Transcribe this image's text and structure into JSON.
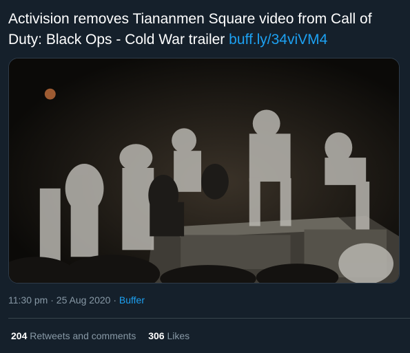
{
  "tweet": {
    "text": "Activision removes Tiananmen Square video from Call of Duty: Black Ops - Cold War trailer",
    "link": "buff.ly/34viVM4"
  },
  "media": {
    "alt": "Dark grainy night photo of a crowd climbing on top of an armored vehicle"
  },
  "meta": {
    "time": "11:30 pm",
    "date": "25 Aug 2020",
    "source": "Buffer",
    "separator": "·"
  },
  "stats": {
    "retweets_count": "204",
    "retweets_label": "Retweets and comments",
    "likes_count": "306",
    "likes_label": "Likes"
  },
  "colors": {
    "background": "#15202b",
    "link": "#1da1f2",
    "muted": "#8899a6"
  }
}
